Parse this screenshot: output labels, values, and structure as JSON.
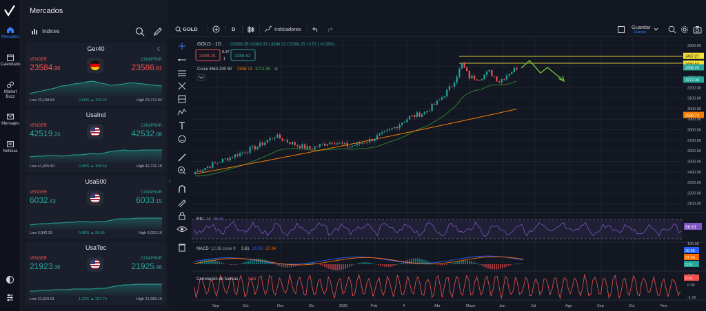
{
  "app": {
    "section_title": "Mercados"
  },
  "rail": {
    "items": [
      {
        "label": "Mercados",
        "icon": "home-icon"
      },
      {
        "label": "Calendario",
        "icon": "calendar-icon"
      },
      {
        "label": "Market Buzz",
        "icon": "buzz-icon"
      },
      {
        "label": "Mensajes",
        "icon": "mail-icon"
      },
      {
        "label": "Noticias",
        "icon": "news-icon"
      }
    ]
  },
  "markets": {
    "list_label": "Indices",
    "sell_label": "VENDER",
    "buy_label": "COMPRAR",
    "cards": [
      {
        "name": "Ger40",
        "sell_main": "23584",
        "sell_dec": ".96",
        "buy_main": "23586",
        "buy_dec": ".81",
        "low": "Low 23,198.84",
        "change": "0.68% ▲ 159.26",
        "high": "High 23,714.94",
        "direction": "down",
        "flag": "de-flag-icon"
      },
      {
        "name": "UsaInd",
        "sell_main": "42519",
        "sell_dec": ".24",
        "buy_main": "42532",
        "buy_dec": ".08",
        "low": "Low 41,925.50",
        "change": "0.85% ▲ 358.64",
        "high": "High 42,731.18",
        "direction": "up",
        "flag": "us-flag-icon"
      },
      {
        "name": "Usa500",
        "sell_main": "6032",
        "sell_dec": ".43",
        "buy_main": "6033",
        "buy_dec": ".15",
        "low": "Low 5,942.30",
        "change": "0.98% ▲ 58.46",
        "high": "High 6,053.16",
        "direction": "up",
        "flag": "us-flag-icon"
      },
      {
        "name": "UsaTec",
        "sell_main": "21923",
        "sell_dec": ".36",
        "buy_main": "21925",
        "buy_dec": ".46",
        "low": "Low 21,515.61",
        "change": "1.23% ▲ 287.74",
        "high": "High 21,989.16",
        "direction": "up",
        "flag": "us-flag-icon"
      }
    ]
  },
  "toolbar": {
    "symbol": "GOLD",
    "interval": "D",
    "indicators_label": "Indicadores",
    "save_label": "Guardar",
    "save_sub": "Guardar"
  },
  "chart": {
    "legend_title": "GOLD · 1D",
    "ohlc": "O3386.35 H3389.33 L3386.22 C3388.25 +3.07 (+0.09%)",
    "sell_box": "3388.25",
    "spread_top": "0.37",
    "spread_bottom": "1",
    "buy_box": "3388.62",
    "ema_label": "Cruce EMA 200 50",
    "ema200_value": "2936.74",
    "ema50_value": "3272.36",
    "ema_icon_text": "⊘",
    "price_axis": [
      "3600.00",
      "3400.00",
      "3300.00",
      "3200.00",
      "3100.00",
      "3000.00",
      "2900.00",
      "2800.00",
      "2700.00",
      "2600.00",
      "2500.00",
      "2400.00",
      "2300.00",
      "2200.00",
      "2100.00"
    ],
    "price_tags": [
      {
        "value": "3497.27",
        "color": "#f5e03a"
      },
      {
        "value": "3430.64",
        "color": "#f5e03a"
      },
      {
        "value": "3388.25",
        "color": "#26a69a"
      },
      {
        "value": "3272.36",
        "color": "#26a69a"
      },
      {
        "value": "2936.74",
        "color": "#f57c00"
      }
    ],
    "time_axis": [
      "Sep",
      "Oct",
      "Nov",
      "Dic",
      "2025",
      "Feb",
      "4",
      "Abr",
      "Mayo",
      "Jun",
      "Jul",
      "Ago",
      "Sep",
      "Oct",
      "Nov"
    ],
    "rsi": {
      "label": "RSI",
      "params": "14",
      "value": "56.61"
    },
    "macd": {
      "label": "MACD",
      "params": "12 26 close 9",
      "v1": "3.61",
      "v2": "30.95",
      "v3": "27.34",
      "axis": [
        "100.00",
        "0.00",
        "-100.00"
      ]
    },
    "corr": {
      "label": "Correlación de fuerzas",
      "value": "0.61",
      "axis": [
        "1.00",
        "0.00",
        "-1.00"
      ]
    }
  },
  "colors": {
    "accent": "#2f7fff",
    "up": "#26a69a",
    "down": "#ef5350",
    "ema200": "#f57c00",
    "ema50": "#2e7d32",
    "level": "#f5e03a"
  }
}
